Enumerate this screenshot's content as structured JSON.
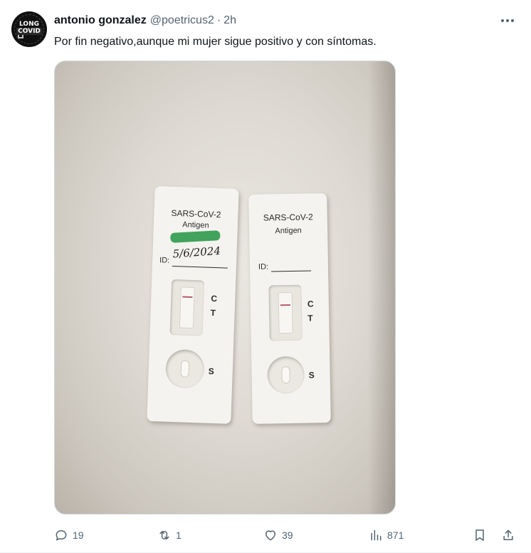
{
  "tweet": {
    "author": {
      "name": "antonio gonzalez",
      "handle": "@poetricus2",
      "separator": "·",
      "time": "2h",
      "avatar_text_line1": "LONG",
      "avatar_text_line2": "COVID"
    },
    "text": "Por fin negativo,aunque mi mujer sigue positivo y con síntomas.",
    "media": {
      "cassette_left": {
        "line1": "SARS-CoV-2",
        "line2": "Antigen",
        "id_label": "ID:",
        "handwritten_date": "5/6/2024",
        "control_mark": "C",
        "test_mark": "T",
        "sample_mark": "S"
      },
      "cassette_right": {
        "line1": "SARS-CoV-2",
        "line2": "Antigen",
        "id_label": "ID:",
        "control_mark": "C",
        "test_mark": "T",
        "sample_mark": "S"
      }
    },
    "actions": {
      "replies": "19",
      "retweets": "1",
      "likes": "39",
      "views": "871"
    },
    "icons": {
      "reply": "reply-icon",
      "retweet": "retweet-icon",
      "like": "heart-icon",
      "views": "views-icon",
      "bookmark": "bookmark-icon",
      "share": "share-icon",
      "more": "more-icon"
    },
    "colors": {
      "text": "#0f1419",
      "secondary": "#536471",
      "border": "#cfd9de"
    }
  }
}
